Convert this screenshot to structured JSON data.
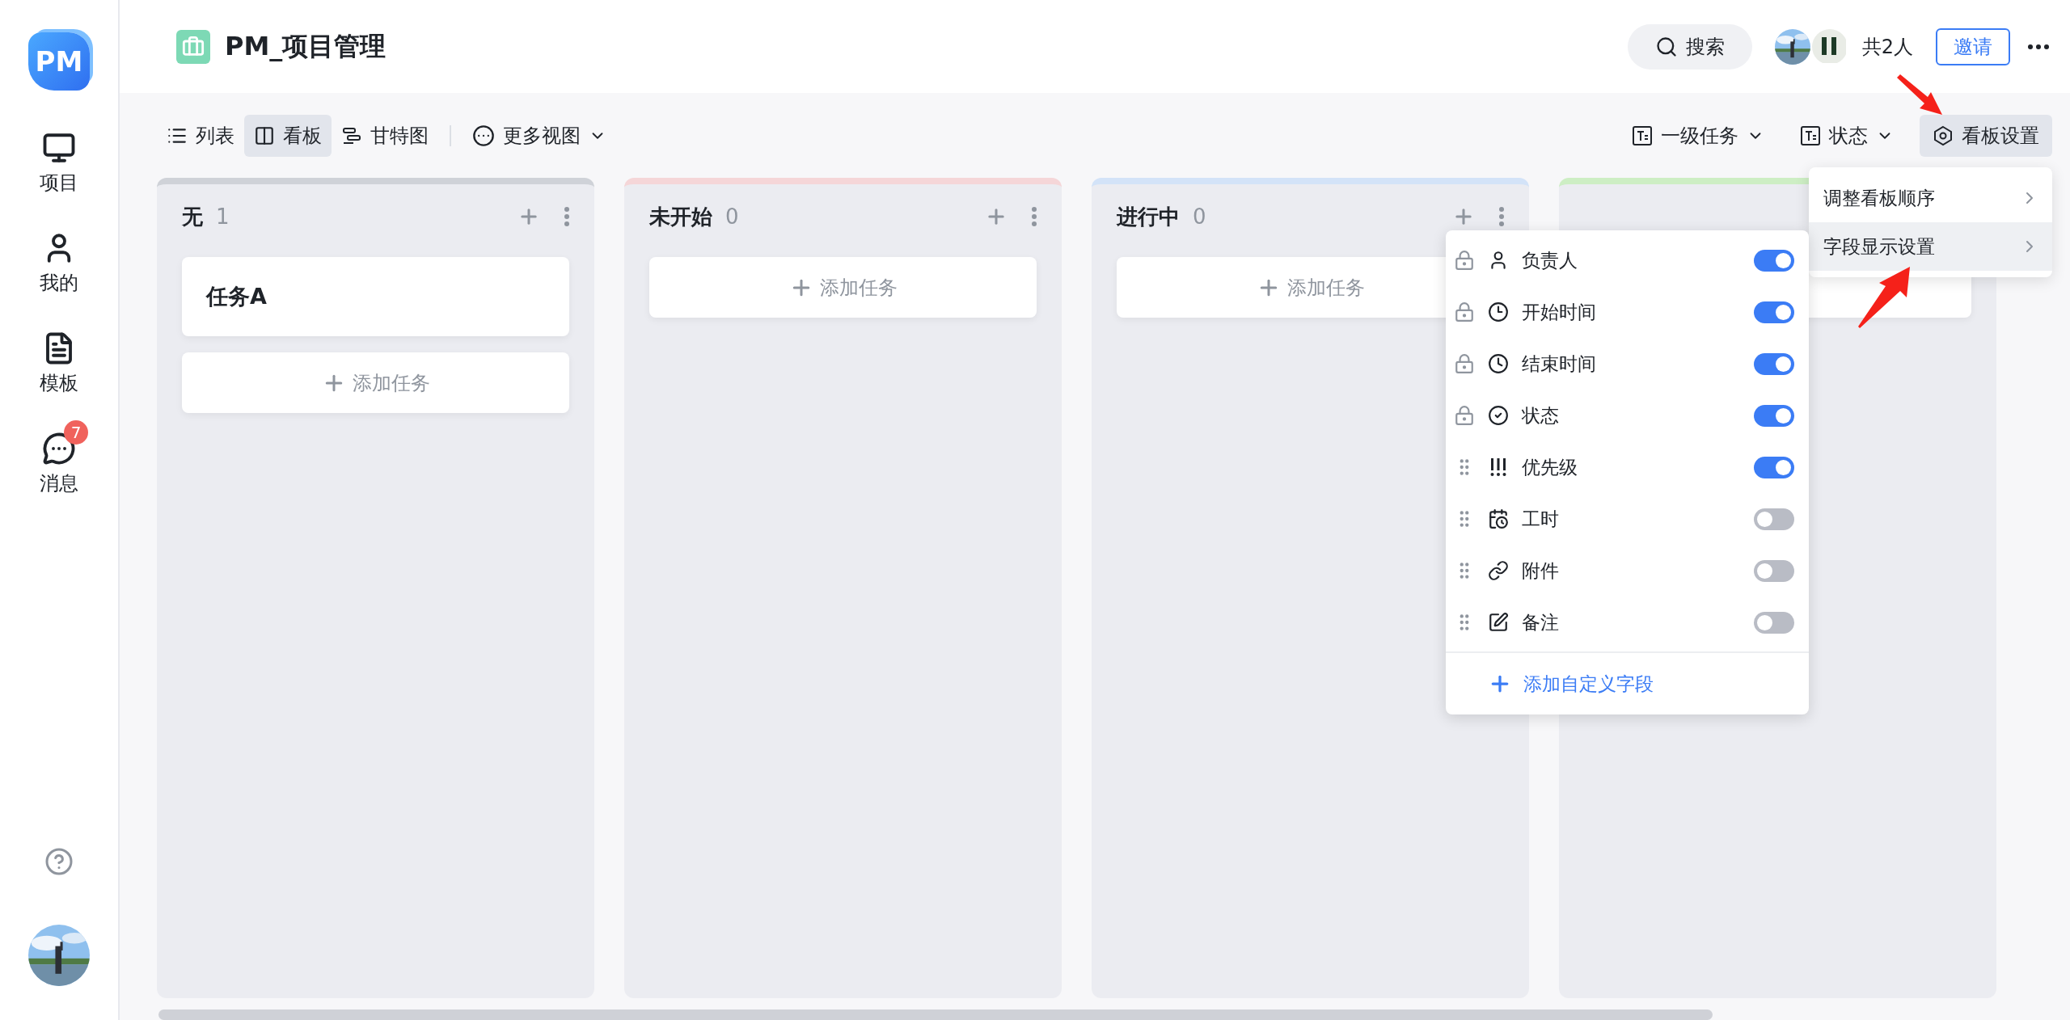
{
  "sidebar": {
    "logo": "PM",
    "items": [
      {
        "label": "项目"
      },
      {
        "label": "我的"
      },
      {
        "label": "模板"
      },
      {
        "label": "消息",
        "badge": "7"
      }
    ]
  },
  "header": {
    "title": "PM_项目管理",
    "search": "搜索",
    "member_count": "共2人",
    "invite": "邀请"
  },
  "toolbar": {
    "views": [
      {
        "label": "列表",
        "selected": false
      },
      {
        "label": "看板",
        "selected": true
      },
      {
        "label": "甘特图",
        "selected": false
      }
    ],
    "more_views": "更多视图",
    "filters": [
      "一级任务",
      "状态"
    ],
    "board_settings": "看板设置"
  },
  "columns": [
    {
      "title": "无",
      "count": "1",
      "color": "#cfd2d8",
      "cards": [
        {
          "title": "任务A"
        }
      ],
      "add_label": "添加任务"
    },
    {
      "title": "未开始",
      "count": "0",
      "color": "#f5d6d8",
      "add_label": "添加任务"
    },
    {
      "title": "进行中",
      "count": "0",
      "color": "#d3e3f8",
      "add_label": "添加任务"
    },
    {
      "color": "#cdeec4"
    }
  ],
  "board_menu": {
    "items": [
      {
        "label": "调整看板顺序",
        "selected": false
      },
      {
        "label": "字段显示设置",
        "selected": true
      }
    ]
  },
  "field_menu": {
    "fields": [
      {
        "label": "负责人",
        "locked": true,
        "on": true
      },
      {
        "label": "开始时间",
        "locked": true,
        "on": true
      },
      {
        "label": "结束时间",
        "locked": true,
        "on": true
      },
      {
        "label": "状态",
        "locked": true,
        "on": true
      },
      {
        "label": "优先级",
        "locked": false,
        "on": true
      },
      {
        "label": "工时",
        "locked": false,
        "on": false
      },
      {
        "label": "附件",
        "locked": false,
        "on": false
      },
      {
        "label": "备注",
        "locked": false,
        "on": false
      }
    ],
    "add_label": "添加自定义字段"
  }
}
